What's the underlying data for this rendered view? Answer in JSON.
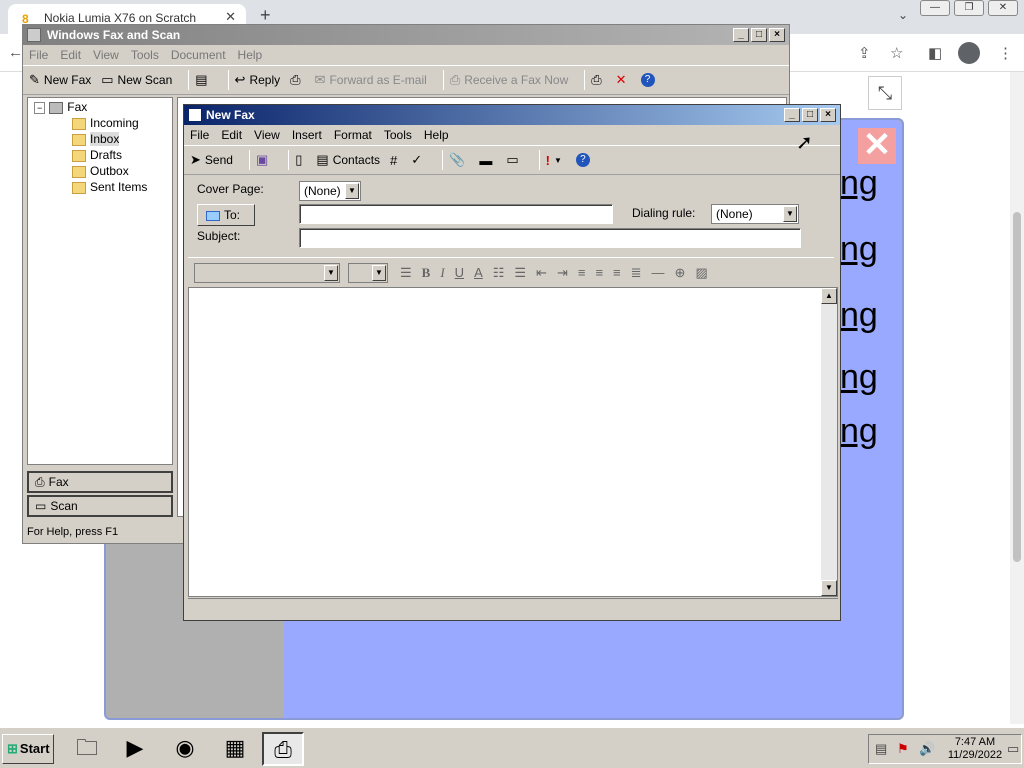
{
  "browser": {
    "tab_title": "Nokia Lumia X76 on Scratch",
    "tab_favicon": "8",
    "tab_close": "✕",
    "new_tab": "+",
    "tab_menu": "⌄",
    "minimize": "—",
    "restore": "❐",
    "close": "✕",
    "back_arrow": "←",
    "share_icon": "⇪",
    "star_icon": "☆",
    "sidepanel_icon": "◧",
    "menu_icon": "⋮",
    "exit_fullscreen_icon": "⤡"
  },
  "stage": {
    "ng_text": "ng",
    "close_sprite": "✕"
  },
  "wfs": {
    "title": "Windows Fax and Scan",
    "menu": [
      "File",
      "Edit",
      "View",
      "Tools",
      "Document",
      "Help"
    ],
    "toolbar": {
      "new_fax": "New Fax",
      "new_scan": "New Scan",
      "reply": "Reply",
      "forward": "Forward as E-mail",
      "receive": "Receive a Fax Now"
    },
    "tree": {
      "root": "Fax",
      "items": [
        "Incoming",
        "Inbox",
        "Drafts",
        "Outbox",
        "Sent Items"
      ],
      "selected": "Inbox"
    },
    "nav": {
      "fax": "Fax",
      "scan": "Scan"
    },
    "status": "For Help, press F1"
  },
  "new_fax": {
    "title": "New Fax",
    "menu": [
      "File",
      "Edit",
      "View",
      "Insert",
      "Format",
      "Tools",
      "Help"
    ],
    "toolbar": {
      "send": "Send",
      "contacts": "Contacts"
    },
    "cover_page_label": "Cover Page:",
    "cover_page_value": "(None)",
    "to_label": "To:",
    "to_value": "",
    "dialing_rule_label": "Dialing rule:",
    "dialing_rule_value": "(None)",
    "subject_label": "Subject:",
    "subject_value": "",
    "format": {
      "bold": "B",
      "italic": "I",
      "underline": "U",
      "color": "A"
    }
  },
  "taskbar": {
    "start": "Start",
    "time": "7:47 AM",
    "date": "11/29/2022"
  }
}
